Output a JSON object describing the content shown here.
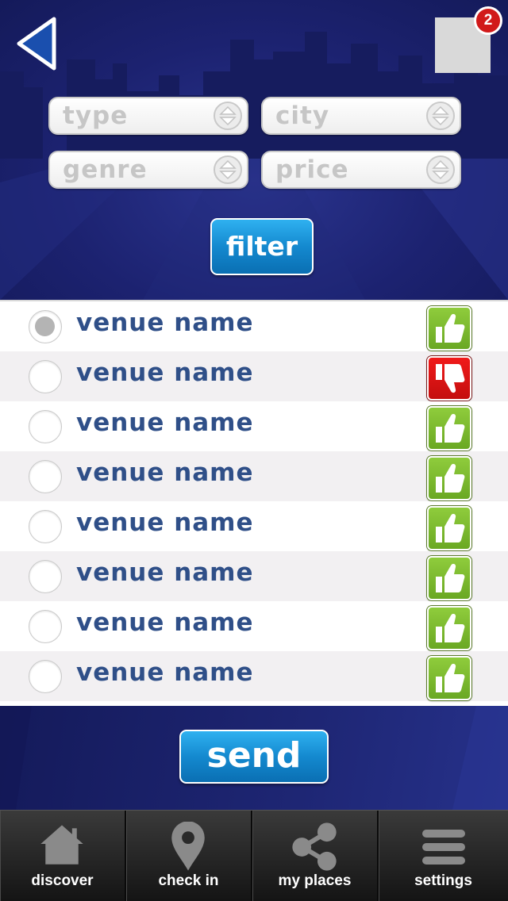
{
  "header": {
    "notification_count": "2"
  },
  "filters": {
    "type_label": "type",
    "city_label": "city",
    "genre_label": "genre",
    "price_label": "price",
    "filter_button": "filter"
  },
  "venues": [
    {
      "name": "venue name",
      "selected": true,
      "rating": "up"
    },
    {
      "name": "venue name",
      "selected": false,
      "rating": "down"
    },
    {
      "name": "venue name",
      "selected": false,
      "rating": "up"
    },
    {
      "name": "venue name",
      "selected": false,
      "rating": "up"
    },
    {
      "name": "venue name",
      "selected": false,
      "rating": "up"
    },
    {
      "name": "venue name",
      "selected": false,
      "rating": "up"
    },
    {
      "name": "venue name",
      "selected": false,
      "rating": "up"
    },
    {
      "name": "venue name",
      "selected": false,
      "rating": "up"
    }
  ],
  "send_button": "send",
  "tabs": [
    {
      "label": "discover",
      "icon": "home-icon"
    },
    {
      "label": "check in",
      "icon": "location-pin-icon"
    },
    {
      "label": "my places",
      "icon": "share-icon"
    },
    {
      "label": "settings",
      "icon": "menu-icon"
    }
  ],
  "colors": {
    "header_bg": "#1c2270",
    "button_blue": "#1489cf",
    "venue_text": "#2f4f88",
    "thumb_up": "#7dbb2f",
    "thumb_down": "#d81414",
    "badge": "#d11a1a"
  }
}
